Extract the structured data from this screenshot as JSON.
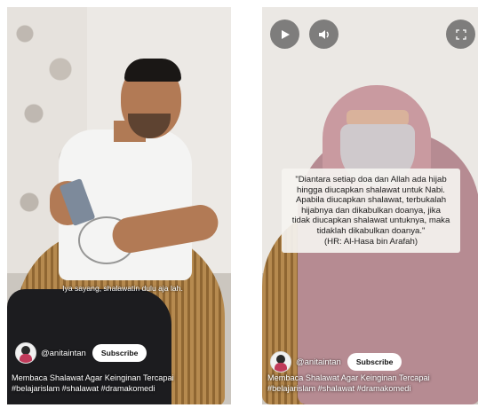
{
  "left_video": {
    "subtitle": "Iya sayang, shalawatin dulu aja lah.",
    "channel": {
      "handle": "@anitaintan",
      "subscribe_label": "Subscribe"
    },
    "title_line1": "Membaca Shalawat Agar Keinginan Tercapai",
    "title_line2": "#belajarislam #shalawat #dramakomedi"
  },
  "right_video": {
    "controls": {
      "play_icon": "play-icon",
      "volume_icon": "volume-icon",
      "fullscreen_icon": "fullscreen-icon"
    },
    "quote": {
      "line1": "\"Diantara setiap doa dan Allah ada hijab",
      "line2": "hingga diucapkan shalawat untuk Nabi.",
      "line3": "Apabila diucapkan shalawat, terbukalah",
      "line4": "hijabnya dan dikabulkan doanya, jika",
      "line5": "tidak diucapkan shalawat untuknya, maka",
      "line6": "tidaklah dikabulkan doanya.\"",
      "source": "(HR: Al-Hasa bin Arafah)"
    },
    "channel": {
      "handle": "@anitaintan",
      "subscribe_label": "Subscribe"
    },
    "title_line1": "Membaca Shalawat Agar Keinginan Tercapai",
    "title_line2": "#belajarislam #shalawat #dramakomedi"
  },
  "colors": {
    "overlay_control_bg": "#3c3c3c",
    "subscribe_bg": "#ffffff",
    "text_on_video": "#ffffff"
  }
}
